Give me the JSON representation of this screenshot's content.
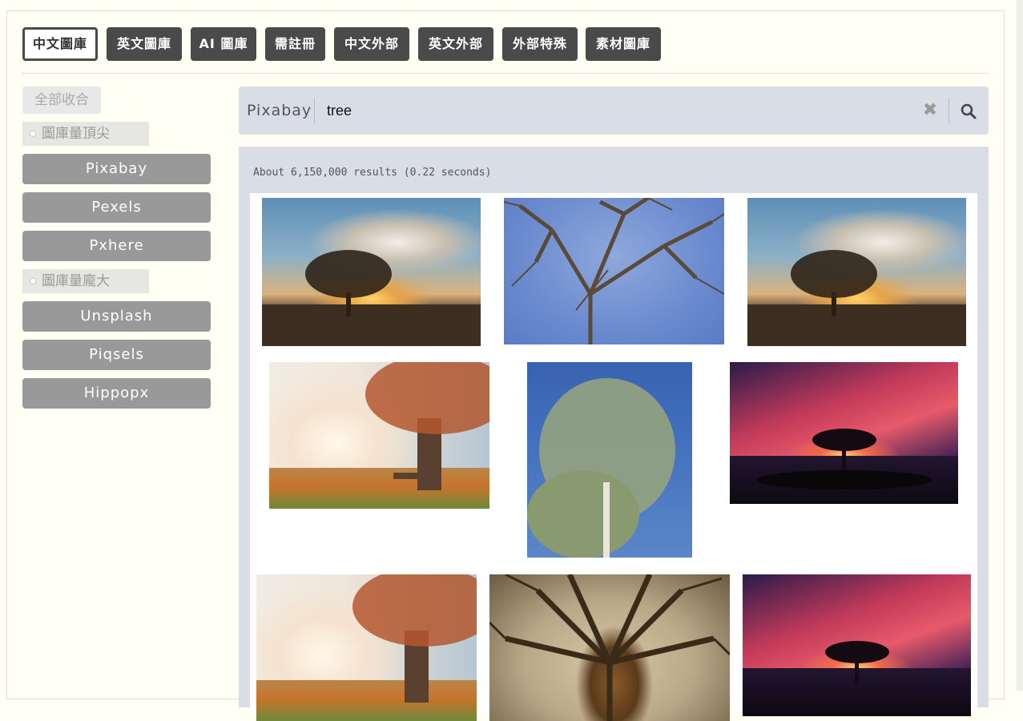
{
  "tabs": [
    {
      "label": "中文圖庫",
      "active": true
    },
    {
      "label": "英文圖庫",
      "active": false
    },
    {
      "label": "AI 圖庫",
      "active": false
    },
    {
      "label": "需註冊",
      "active": false
    },
    {
      "label": "中文外部",
      "active": false
    },
    {
      "label": "英文外部",
      "active": false
    },
    {
      "label": "外部特殊",
      "active": false
    },
    {
      "label": "素材圖庫",
      "active": false
    }
  ],
  "sidebar": {
    "collapse_all": "全部收合",
    "groups": [
      {
        "label": "圖庫量頂尖",
        "sites": [
          "Pixabay",
          "Pexels",
          "Pxhere"
        ]
      },
      {
        "label": "圖庫量龐大",
        "sites": [
          "Unsplash",
          "Piqsels",
          "Hippopx"
        ]
      }
    ]
  },
  "search": {
    "source": "Pixabay",
    "query": "tree",
    "clear_icon": "close-icon",
    "search_icon": "search-icon"
  },
  "results": {
    "stats": "About 6,150,000 results (0.22 seconds)",
    "images": [
      {
        "subject": "lone tree at sunset field"
      },
      {
        "subject": "bare branches blue sky"
      },
      {
        "subject": "lone tree at sunset field"
      },
      {
        "subject": "autumn tree with bench"
      },
      {
        "subject": "eucalyptus tree blue sky"
      },
      {
        "subject": "tree silhouette red sky"
      },
      {
        "subject": "autumn tree with bench"
      },
      {
        "subject": "large old tree branches"
      },
      {
        "subject": "tree silhouette red sky"
      }
    ]
  }
}
